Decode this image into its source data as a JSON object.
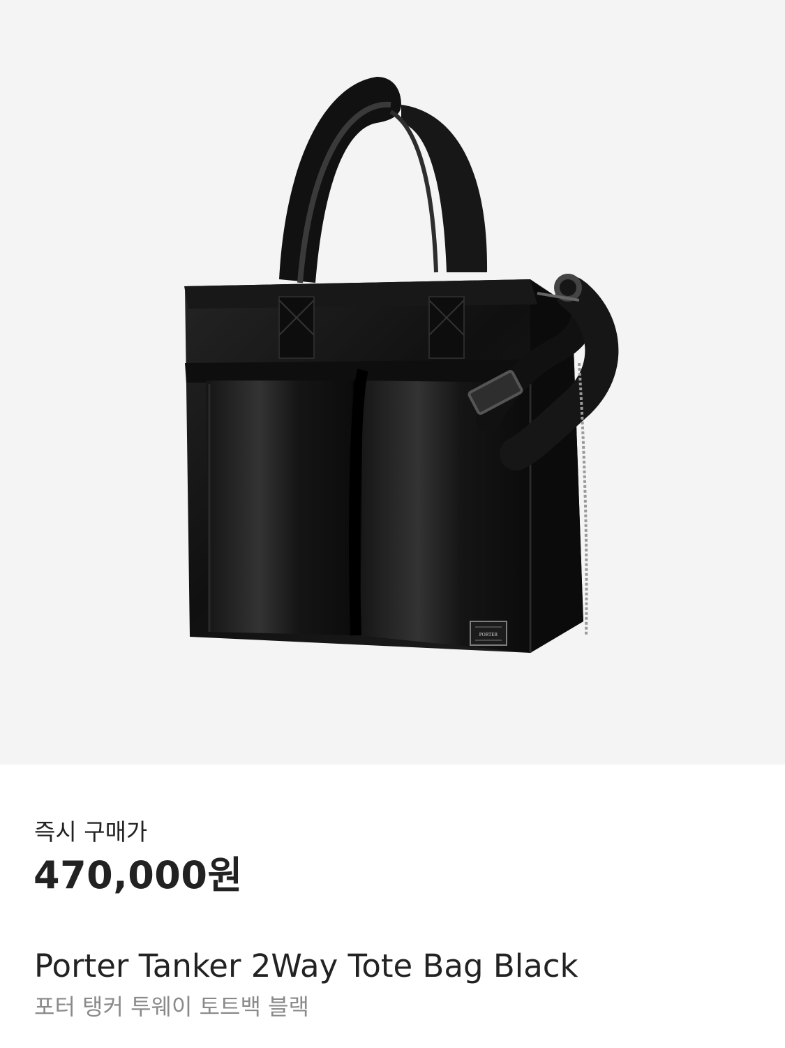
{
  "product": {
    "image_alt": "Porter Tanker 2Way Tote Bag Black",
    "logo_text": "PORTER",
    "price_label": "즉시 구매가",
    "price": "470,000원",
    "name_en": "Porter Tanker 2Way Tote Bag Black",
    "name_ko": "포터 탱커 투웨이 토트백 블랙"
  },
  "colors": {
    "image_background": "#f4f4f4",
    "bag": "#151515",
    "text": "#222222",
    "subtext": "#8a8a8a"
  }
}
